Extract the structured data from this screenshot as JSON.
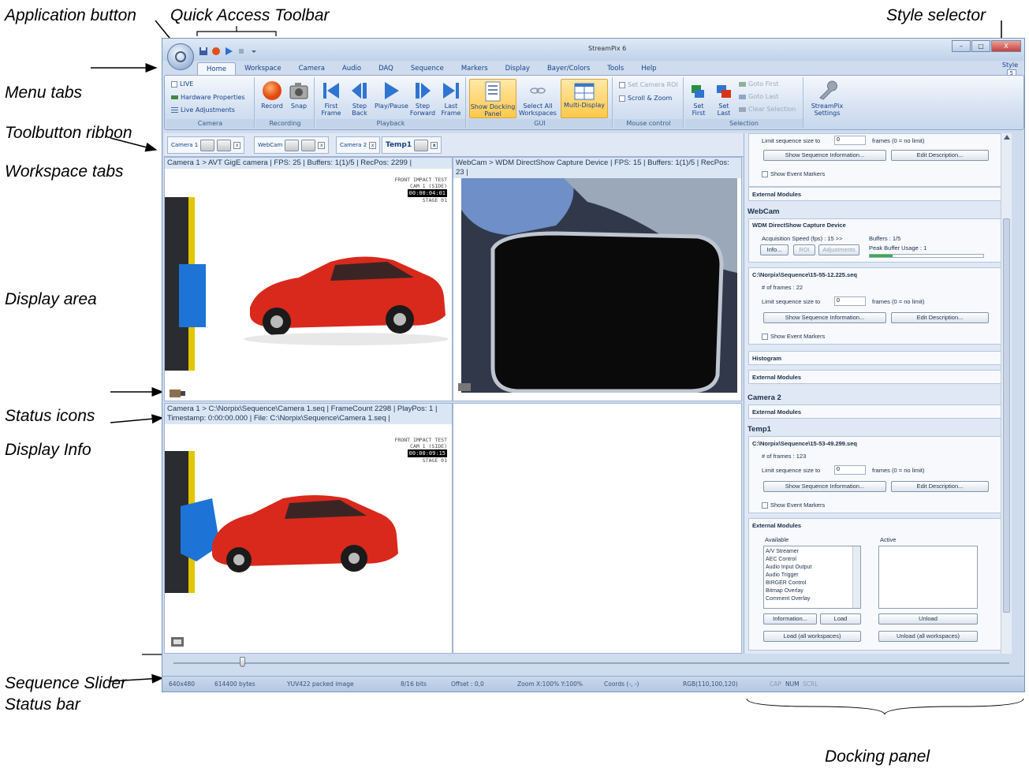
{
  "callouts": {
    "application_button": "Application button",
    "quick_access_toolbar": "Quick Access Toolbar",
    "style_selector": "Style selector",
    "menu_tabs": "Menu tabs",
    "toolbutton_ribbon": "Toolbutton ribbon",
    "workspace_tabs": "Workspace tabs",
    "display_area": "Display area",
    "status_icons": "Status icons",
    "display_info": "Display Info",
    "sequence_slider": "Sequence Slider",
    "status_bar": "Status bar",
    "docking_panel": "Docking panel"
  },
  "window": {
    "title": "StreamPix 6",
    "min_label": "–",
    "max_label": "□",
    "close_label": "X"
  },
  "menu_tabs": [
    "Home",
    "Workspace",
    "Camera",
    "Audio",
    "DAQ",
    "Sequence",
    "Markers",
    "Display",
    "Bayer/Colors",
    "Tools",
    "Help"
  ],
  "style_selector": {
    "label": "Style",
    "value": "5"
  },
  "ribbon": {
    "camera": {
      "live": "LIVE",
      "hardware_properties": "Hardware Properties",
      "live_adjustments": "Live Adjustments",
      "group": "Camera"
    },
    "recording": {
      "record": "Record",
      "snap": "Snap",
      "group": "Recording"
    },
    "playback": {
      "first_frame": "First Frame",
      "step_back": "Step Back",
      "play_pause": "Play/Pause",
      "step_forward": "Step Forward",
      "last_frame": "Last Frame",
      "group": "Playback"
    },
    "gui": {
      "show_docking_panel": "Show Docking Panel",
      "select_all_workspaces": "Select All Workspaces",
      "multi_display": "Multi-Display",
      "group": "GUI"
    },
    "mouse": {
      "set_camera_roi": "Set Camera ROI",
      "scroll_zoom": "Scroll & Zoom",
      "group": "Mouse control"
    },
    "selection": {
      "set_first": "Set First",
      "set_last": "Set Last",
      "goto_first": "Goto First",
      "goto_last": "Goto Last",
      "clear_selection": "Clear Selection",
      "group": "Selection"
    },
    "settings": {
      "label": "StreamPix Settings"
    }
  },
  "workspace_tabs": [
    {
      "label": "Camera 1"
    },
    {
      "label": "WebCam"
    },
    {
      "label": "Camera 2"
    },
    {
      "label": "Temp1"
    }
  ],
  "displays": {
    "top_left_info": "Camera 1 > AVT GigE camera | FPS: 25 | Buffers: 1(1)/5 | RecPos: 2299 |",
    "top_right_info": "WebCam > WDM DirectShow Capture Device | FPS: 15 | Buffers: 1(1)/5 | RecPos: 23 |",
    "bottom_left_info": "Camera 1 > C:\\Norpix\\Sequence\\Camera 1.seq | FrameCount 2298 | PlayPos: 1 | Timestamp: 0:00:00.000 | File: C:\\Norpix\\Sequence\\Camera 1.seq |",
    "overlay_top": {
      "line1": "FRONT IMPACT TEST",
      "line2": "CAM 1 (SIDE)",
      "time": "00:00:04:01",
      "stage": "STAGE 01"
    },
    "overlay_bottom": {
      "line1": "FRONT IMPACT TEST",
      "line2": "CAM 1 (SIDE)",
      "time": "00:00:09:15",
      "stage": "STAGE 01"
    }
  },
  "dock": {
    "limit_label": "Limit sequence size to",
    "limit_value": "0",
    "frames_nolimit": "frames (0 = no limit)",
    "show_seq_info": "Show Sequence Information...",
    "edit_desc": "Edit Description...",
    "show_event_markers": "Show Event Markers",
    "external_modules": "External Modules",
    "webcam": {
      "title": "WebCam",
      "device": "WDM DirectShow Capture Device",
      "acq_speed": "Acquisition Speed (fps) : 15 >>",
      "buffers": "Buffers : 1/5",
      "peak_usage": "Peak Buffer Usage : 1",
      "info": "Info...",
      "roi": "ROI",
      "adjustments": "Adjustments",
      "buffer_fraction": 0.2,
      "seq_path": "C:\\Norpix\\Sequence\\15-55-12.225.seq",
      "num_frames": "# of frames : 22",
      "histogram": "Histogram"
    },
    "camera2": {
      "title": "Camera 2"
    },
    "temp1": {
      "title": "Temp1",
      "seq_path": "C:\\Norpix\\Sequence\\15-53-49.299.seq",
      "num_frames": "# of frames : 123",
      "available": "Available",
      "active": "Active",
      "modules": [
        "A/V Streamer",
        "AEC Control",
        "Audio Input Output",
        "Audio Trigger",
        "BIRGER Control",
        "Bitmap Overlay",
        "Comment Overlay"
      ],
      "information": "Information...",
      "load": "Load",
      "unload": "Unload",
      "load_all": "Load (all workspaces)",
      "unload_all": "Unload (all workspaces)"
    }
  },
  "statusbar": {
    "resolution": "640x480",
    "bytes": "614400 bytes",
    "format": "YUV422 packed image",
    "bits": "8/16 bits",
    "offset": "Offset : 0,0",
    "zoom": "Zoom X:100% Y:100%",
    "coords": "Coords (-, -)",
    "rgb": "RGB(110,100,120)",
    "cap": "CAP",
    "num": "NUM",
    "scrl": "SCRL"
  },
  "colors": {
    "ribbon_blue": "#15428b",
    "car_red": "#d8291c",
    "highlight": "#ffc84b"
  }
}
